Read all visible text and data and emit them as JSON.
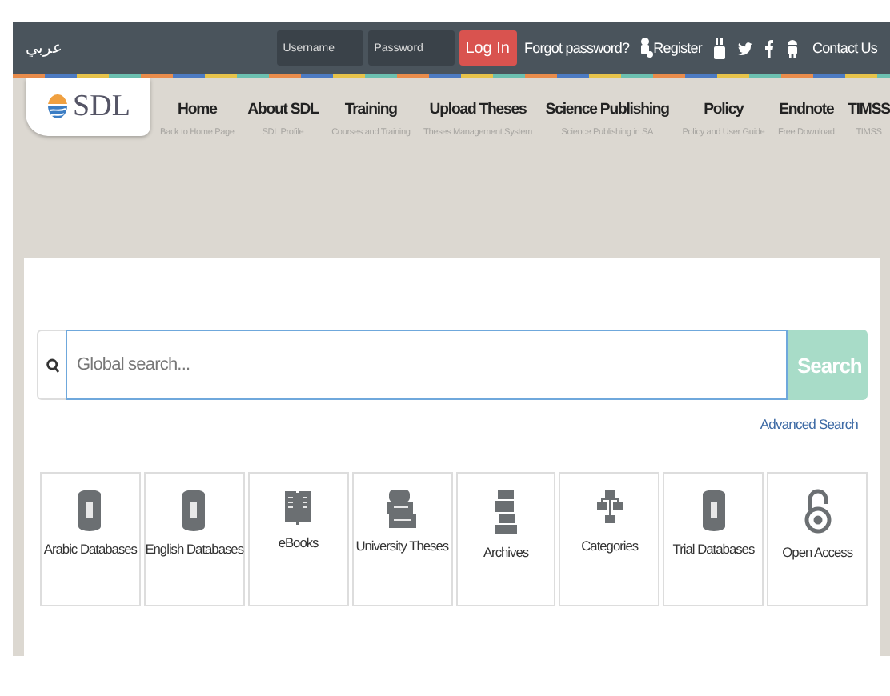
{
  "topbar": {
    "language": "عربي",
    "username": {
      "placeholder": "Username"
    },
    "password": {
      "placeholder": "Password"
    },
    "login": "Log In",
    "forgot": "Forgot password?",
    "register": "Register",
    "contact": "Contact Us"
  },
  "logo": "SDL",
  "nav": [
    {
      "title": "Home",
      "subtitle": "Back to Home Page"
    },
    {
      "title": "About SDL",
      "subtitle": "SDL Profile"
    },
    {
      "title": "Training",
      "subtitle": "Courses and Training"
    },
    {
      "title": "Upload Theses",
      "subtitle": "Theses Management System"
    },
    {
      "title": "Science Publishing",
      "subtitle": "Science Publishing in SA"
    },
    {
      "title": "Policy",
      "subtitle": "Policy and User Guide"
    },
    {
      "title": "Endnote",
      "subtitle": "Free Download"
    },
    {
      "title": "TIMSS",
      "subtitle": "TIMSS"
    }
  ],
  "search": {
    "placeholder": "Global search...",
    "button": "Search",
    "advanced": "Advanced Search"
  },
  "categories": [
    {
      "label": "Arabic Databases",
      "kind": "database"
    },
    {
      "label": "English Databases",
      "kind": "database"
    },
    {
      "label": "eBooks",
      "kind": "book"
    },
    {
      "label": "University Theses",
      "kind": "stack"
    },
    {
      "label": "Archives",
      "kind": "archive"
    },
    {
      "label": "Categories",
      "kind": "tree"
    },
    {
      "label": "Trial Databases",
      "kind": "database"
    },
    {
      "label": "Open Access",
      "kind": "lock"
    }
  ]
}
